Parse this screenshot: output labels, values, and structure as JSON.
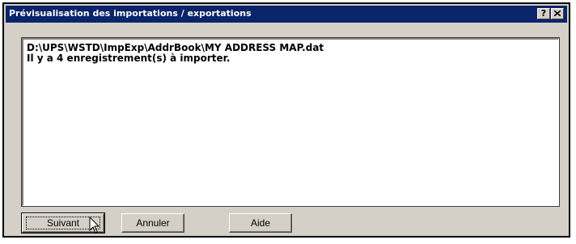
{
  "dialog": {
    "title": "Prévisualisation des importations / exportations",
    "help_button": "?",
    "close_icon": "close-icon"
  },
  "preview": {
    "file_path": "D:\\UPS\\WSTD\\ImpExp\\AddrBook\\MY ADDRESS MAP.dat",
    "record_message": "Il y a 4 enregistrement(s) à importer."
  },
  "buttons": {
    "next": "Suivant",
    "cancel": "Annuler",
    "help": "Aide"
  },
  "colors": {
    "titlebar": "#0a246a",
    "face": "#d4d0c8"
  }
}
